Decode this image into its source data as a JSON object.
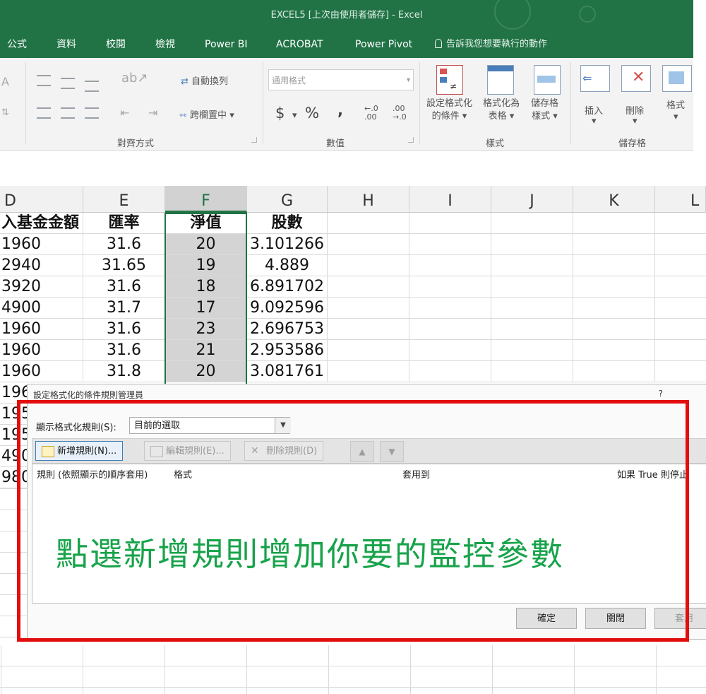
{
  "window": {
    "title": "EXCEL5 [上次由使用者儲存] - Excel"
  },
  "tabs": [
    "公式",
    "資料",
    "校閱",
    "檢視",
    "Power BI",
    "ACROBAT",
    "Power Pivot"
  ],
  "tell_me": "告訴我您想要執行的動作",
  "ribbon": {
    "wrap_text": "自動換列",
    "merge_center": "跨欄置中",
    "alignment_group": "對齊方式",
    "number_format": "通用格式",
    "currency": "$",
    "percent": "%",
    "comma": ",",
    "inc_decimal": "←.0 .00",
    "dec_decimal": ".00 →.0",
    "number_group": "數值",
    "conditional_formatting": [
      "設定格式化",
      "的條件"
    ],
    "format_as_table": [
      "格式化為",
      "表格"
    ],
    "cell_styles": [
      "儲存格",
      "樣式"
    ],
    "styles_group": "樣式",
    "insert": "插入",
    "delete": "刪除",
    "format": "格式",
    "cells_group": "儲存格"
  },
  "columns": [
    "D",
    "E",
    "F",
    "G",
    "H",
    "I",
    "J",
    "K",
    "L"
  ],
  "table": {
    "headers": [
      "入基金金額",
      "匯率",
      "淨值",
      "股數"
    ],
    "rows": [
      [
        "1960",
        "31.6",
        "20",
        "3.101266"
      ],
      [
        "2940",
        "31.65",
        "19",
        "4.889"
      ],
      [
        "3920",
        "31.6",
        "18",
        "6.891702"
      ],
      [
        "4900",
        "31.7",
        "17",
        "9.092596"
      ],
      [
        "1960",
        "31.6",
        "23",
        "2.696753"
      ],
      [
        "1960",
        "31.6",
        "21",
        "2.953586"
      ],
      [
        "1960",
        "31.8",
        "20",
        "3.081761"
      ]
    ],
    "partial_rows": [
      "196",
      "195",
      "195",
      "490",
      "980"
    ]
  },
  "dialog": {
    "title": "設定格式化的條件規則管理員",
    "help": "?",
    "show_rules_label": "顯示格式化規則(S):",
    "show_rules_value": "目前的選取",
    "new_rule": "新增規則(N)...",
    "edit_rule": "編輯規則(E)...",
    "delete_rule": "刪除規則(D)",
    "move_up": "▲",
    "move_down": "▼",
    "col_rule": "規則 (依照顯示的順序套用)",
    "col_format": "格式",
    "col_applies": "套用到",
    "col_stop": "如果 True 則停止",
    "ok": "確定",
    "close": "關閉",
    "apply": "套用"
  },
  "annotation": "點選新增規則增加你要的監控參數",
  "colors": {
    "excel_green": "#217346",
    "highlight_red": "#e20d0d",
    "annotation_green": "#17a34a"
  }
}
